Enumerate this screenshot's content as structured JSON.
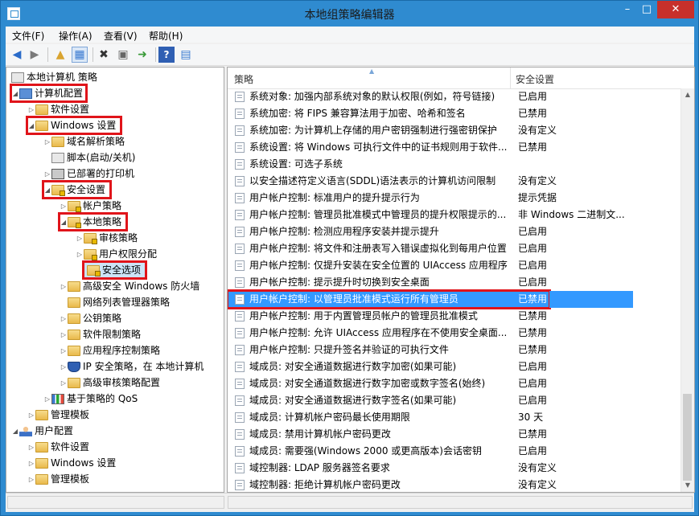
{
  "window": {
    "title": "本地组策略编辑器"
  },
  "menu": [
    "文件(F)",
    "操作(A)",
    "查看(V)",
    "帮助(H)"
  ],
  "tree": {
    "root": "本地计算机 策略",
    "computer_config": "计算机配置",
    "software_settings": "软件设置",
    "windows_settings": "Windows 设置",
    "name_resolution": "域名解析策略",
    "scripts": "脚本(启动/关机)",
    "deployed_printers": "已部署的打印机",
    "security_settings": "安全设置",
    "account_policies": "帐户策略",
    "local_policies": "本地策略",
    "audit_policy": "审核策略",
    "user_rights": "用户权限分配",
    "security_options": "安全选项",
    "firewall": "高级安全 Windows 防火墙",
    "network_list": "网络列表管理器策略",
    "public_key": "公钥策略",
    "software_restriction": "软件限制策略",
    "app_control": "应用程序控制策略",
    "ip_security": "IP 安全策略，在 本地计算机",
    "advanced_audit": "高级审核策略配置",
    "qos": "基于策略的 QoS",
    "admin_templates": "管理模板",
    "user_config": "用户配置",
    "user_software_settings": "软件设置",
    "user_windows_settings": "Windows 设置",
    "user_admin_templates": "管理模板"
  },
  "list": {
    "col_policy": "策略",
    "col_setting": "安全设置",
    "rows": [
      {
        "name": "系统对象: 加强内部系统对象的默认权限(例如，符号链接)",
        "value": "已启用"
      },
      {
        "name": "系统加密: 将 FIPS 兼容算法用于加密、哈希和签名",
        "value": "已禁用"
      },
      {
        "name": "系统加密: 为计算机上存储的用户密钥强制进行强密钥保护",
        "value": "没有定义"
      },
      {
        "name": "系统设置: 将 Windows 可执行文件中的证书规则用于软件...",
        "value": "已禁用"
      },
      {
        "name": "系统设置: 可选子系统",
        "value": ""
      },
      {
        "name": "以安全描述符定义语言(SDDL)语法表示的计算机访问限制",
        "value": "没有定义"
      },
      {
        "name": "用户帐户控制: 标准用户的提升提示行为",
        "value": "提示凭据"
      },
      {
        "name": "用户帐户控制: 管理员批准模式中管理员的提升权限提示的...",
        "value": "非 Windows 二进制文..."
      },
      {
        "name": "用户帐户控制: 检测应用程序安装并提示提升",
        "value": "已启用"
      },
      {
        "name": "用户帐户控制: 将文件和注册表写入错误虚拟化到每用户位置",
        "value": "已启用"
      },
      {
        "name": "用户帐户控制: 仅提升安装在安全位置的 UIAccess 应用程序",
        "value": "已启用"
      },
      {
        "name": "用户帐户控制: 提示提升时切换到安全桌面",
        "value": "已启用"
      },
      {
        "name": "用户帐户控制: 以管理员批准模式运行所有管理员",
        "value": "已禁用"
      },
      {
        "name": "用户帐户控制: 用于内置管理员帐户的管理员批准模式",
        "value": "已禁用"
      },
      {
        "name": "用户帐户控制: 允许 UIAccess 应用程序在不使用安全桌面...",
        "value": "已禁用"
      },
      {
        "name": "用户帐户控制: 只提升签名并验证的可执行文件",
        "value": "已禁用"
      },
      {
        "name": "域成员: 对安全通道数据进行数字加密(如果可能)",
        "value": "已启用"
      },
      {
        "name": "域成员: 对安全通道数据进行数字加密或数字签名(始终)",
        "value": "已启用"
      },
      {
        "name": "域成员: 对安全通道数据进行数字签名(如果可能)",
        "value": "已启用"
      },
      {
        "name": "域成员: 计算机帐户密码最长使用期限",
        "value": "30 天"
      },
      {
        "name": "域成员: 禁用计算机帐户密码更改",
        "value": "已禁用"
      },
      {
        "name": "域成员: 需要强(Windows 2000 或更高版本)会话密钥",
        "value": "已启用"
      },
      {
        "name": "域控制器: LDAP 服务器签名要求",
        "value": "没有定义"
      },
      {
        "name": "域控制器: 拒绝计算机帐户密码更改",
        "value": "没有定义"
      }
    ]
  },
  "colors": {
    "selection": "#3399ff",
    "highlight_box": "#e0141a",
    "title_bar": "#2f8bd0"
  }
}
